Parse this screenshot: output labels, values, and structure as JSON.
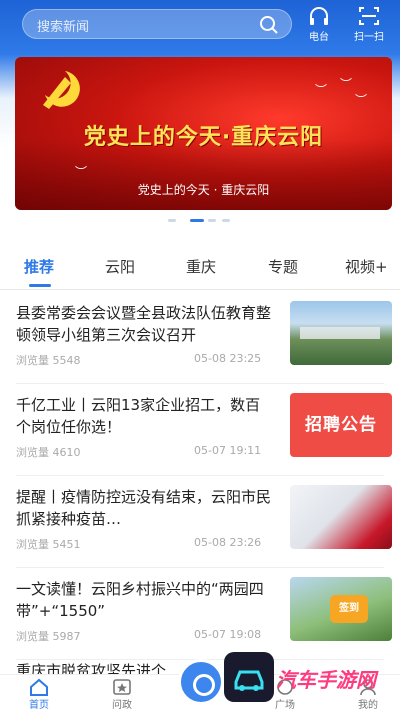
{
  "search": {
    "placeholder": "搜索新闻"
  },
  "top_actions": {
    "radio_label": "电台",
    "scan_label": "扫一扫"
  },
  "banner": {
    "title": "党史上的今天·重庆云阳",
    "caption": "党史上的今天 · 重庆云阳"
  },
  "carousel": {
    "page_count": 4,
    "active_index": 1
  },
  "tabs": [
    {
      "label": "推荐",
      "active": true
    },
    {
      "label": "云阳",
      "active": false
    },
    {
      "label": "重庆",
      "active": false
    },
    {
      "label": "专题",
      "active": false
    },
    {
      "label": "视频+",
      "active": false
    }
  ],
  "news": [
    {
      "title": "县委常委会会议暨全县政法队伍教育整顿领导小组第三次会议召开",
      "views": "浏览量 5548",
      "time": "05-08 23:25",
      "thumb": "city-photo",
      "thumb_text": ""
    },
    {
      "title": "千亿工业丨云阳13家企业招工，数百个岗位任你选！",
      "views": "浏览量 4610",
      "time": "05-07 19:11",
      "thumb": "recruit-card",
      "thumb_text": "招聘公告"
    },
    {
      "title": "提醒丨疫情防控远没有结束，云阳市民抓紧接种疫苗…",
      "views": "浏览量 5451",
      "time": "05-08 23:26",
      "thumb": "vaccine-photo",
      "thumb_text": ""
    },
    {
      "title": "一文读懂！云阳乡村振兴中的“两园四带”+“1550”",
      "views": "浏览量 5987",
      "time": "05-07 19:08",
      "thumb": "checkin-photo",
      "thumb_text": "签到"
    }
  ],
  "partial_news_title": "重庆市脱贫攻坚先进个",
  "bottom_nav": [
    {
      "label": "首页",
      "active": true
    },
    {
      "label": "问政",
      "active": false
    },
    {
      "label": "广场",
      "active": false
    },
    {
      "label": "我的",
      "active": false
    }
  ],
  "watermark": {
    "text": "汽车手游网"
  },
  "colors": {
    "accent": "#2f7ae8",
    "banner_red": "#c9150f",
    "recruit_red": "#ef4c45"
  }
}
